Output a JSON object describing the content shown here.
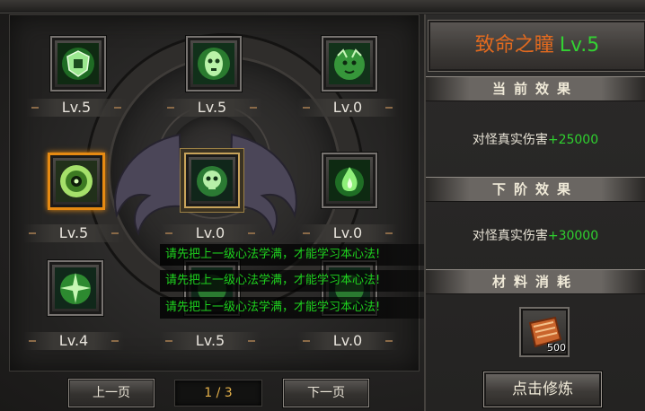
{
  "skills": [
    {
      "icon": "shield-rune-icon",
      "level": "Lv.5",
      "state": "normal"
    },
    {
      "icon": "tribal-mask-icon",
      "level": "Lv.5",
      "state": "normal"
    },
    {
      "icon": "tiger-head-icon",
      "level": "Lv.0",
      "state": "normal"
    },
    {
      "icon": "eye-orb-icon",
      "level": "Lv.5",
      "state": "selected"
    },
    {
      "icon": "skull-ring-icon",
      "level": "Lv.0",
      "state": "current"
    },
    {
      "icon": "green-flame-icon",
      "level": "Lv.0",
      "state": "normal"
    },
    {
      "icon": "spirit-burst-icon",
      "level": "Lv.4",
      "state": "normal"
    },
    {
      "icon": "skill-icon",
      "level": "Lv.5",
      "state": "normal"
    },
    {
      "icon": "skill-icon",
      "level": "Lv.0",
      "state": "normal"
    }
  ],
  "messages": [
    "请先把上一级心法学满，才能学习本心法!",
    "请先把上一级心法学满，才能学习本心法!",
    "请先把上一级心法学满，才能学习本心法!"
  ],
  "pager": {
    "prev": "上一页",
    "indicator": "1 / 3",
    "next": "下一页"
  },
  "detail": {
    "name": "致命之瞳",
    "level": "Lv.5",
    "current_effect_heading": "当前效果",
    "current_effect_label": "对怪真实伤害",
    "current_effect_value": "+25000",
    "next_effect_heading": "下阶效果",
    "next_effect_label": "对怪真实伤害",
    "next_effect_value": "+30000",
    "material_heading": "材料消耗",
    "material_icon": "scroll-book-icon",
    "material_count": "500",
    "practice_button": "点击修炼"
  },
  "colors": {
    "highlight_green": "#2fd12f",
    "title_orange": "#e26a1f",
    "selected_border": "#e68a12"
  }
}
